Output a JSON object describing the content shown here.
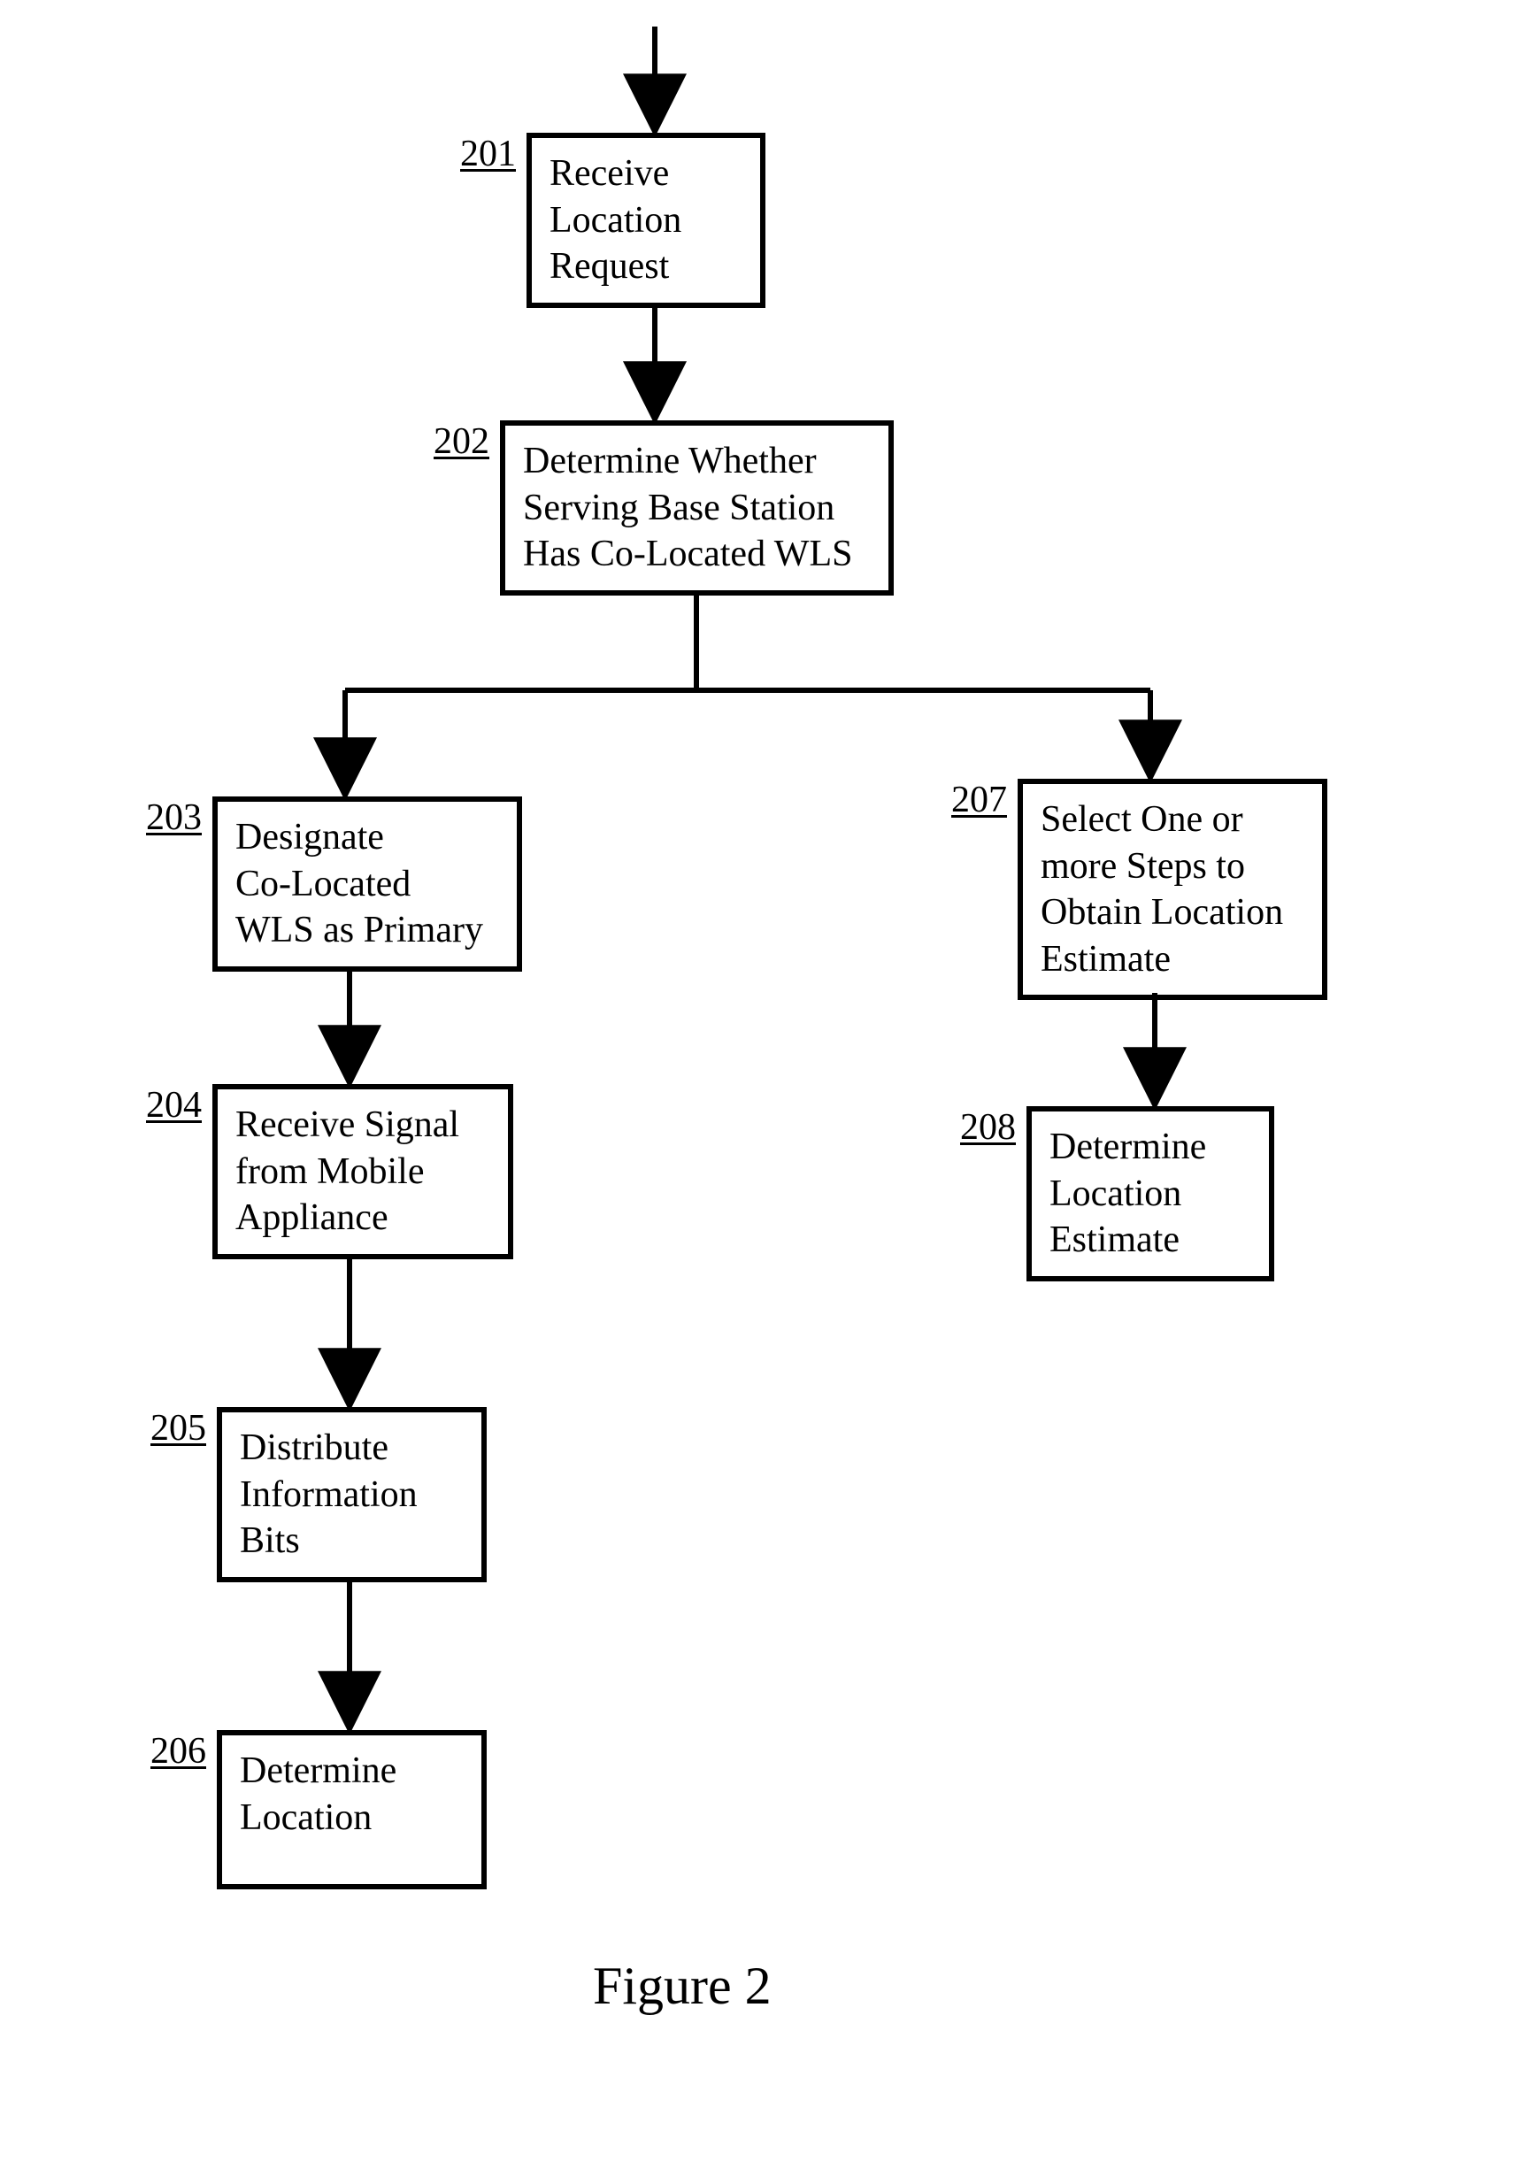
{
  "nodes": {
    "201": {
      "num": "201",
      "text": "Receive\nLocation\nRequest"
    },
    "202": {
      "num": "202",
      "text": "Determine Whether\nServing Base Station\nHas Co-Located WLS"
    },
    "203": {
      "num": "203",
      "text": "Designate\nCo-Located\nWLS as Primary"
    },
    "204": {
      "num": "204",
      "text": "Receive Signal\nfrom Mobile\nAppliance"
    },
    "205": {
      "num": "205",
      "text": "Distribute\nInformation\nBits"
    },
    "206": {
      "num": "206",
      "text": "Determine\nLocation"
    },
    "207": {
      "num": "207",
      "text": "Select One or\nmore Steps to\nObtain Location\nEstimate"
    },
    "208": {
      "num": "208",
      "text": "Determine\nLocation\nEstimate"
    }
  },
  "caption": "Figure 2"
}
